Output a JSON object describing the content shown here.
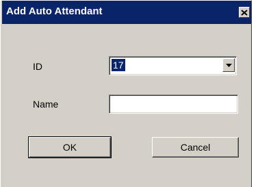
{
  "dialog": {
    "title": "Add Auto Attendant",
    "close_icon": "close-x-icon"
  },
  "form": {
    "id_label": "ID",
    "id_value": "17",
    "name_label": "Name",
    "name_value": "",
    "dropdown_icon": "chevron-down-icon"
  },
  "buttons": {
    "ok_label": "OK",
    "cancel_label": "Cancel"
  },
  "colors": {
    "titlebar": "#0a246a",
    "face": "#d4d0c8",
    "selection": "#0a246a"
  }
}
